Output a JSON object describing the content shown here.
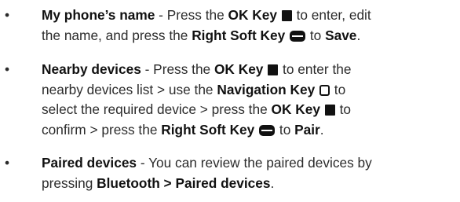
{
  "bullet": "•",
  "items": [
    {
      "title": "My phone’s name",
      "l1a": " - Press the ",
      "ok_key": "OK Key",
      "l1b": " to enter, edit",
      "l2a": "the name, and press the ",
      "right_soft_key": "Right Soft Key",
      "l2b": " to ",
      "action": "Save",
      "l2c": "."
    },
    {
      "title": "Nearby devices",
      "l1a": " - Press the ",
      "ok_key": "OK Key",
      "l1b": " to enter the",
      "l2a": "nearby devices list > use the ",
      "nav_key": "Navigation Key",
      "l2b": " to",
      "l3a": "select the required device > press the ",
      "ok_key2": "OK Key",
      "l3b": " to",
      "l4a": "confirm > press the ",
      "right_soft_key": "Right Soft Key",
      "l4b": " to ",
      "action": "Pair",
      "l4c": "."
    },
    {
      "title": "Paired devices",
      "l1a": " - You can review the paired devices by",
      "l2a": "pressing ",
      "path": "Bluetooth > Paired devices",
      "l2b": "."
    }
  ],
  "icons": {
    "ok_key": "ok-key-icon",
    "right_soft_key": "right-soft-key-icon",
    "navigation_key": "navigation-key-icon"
  }
}
